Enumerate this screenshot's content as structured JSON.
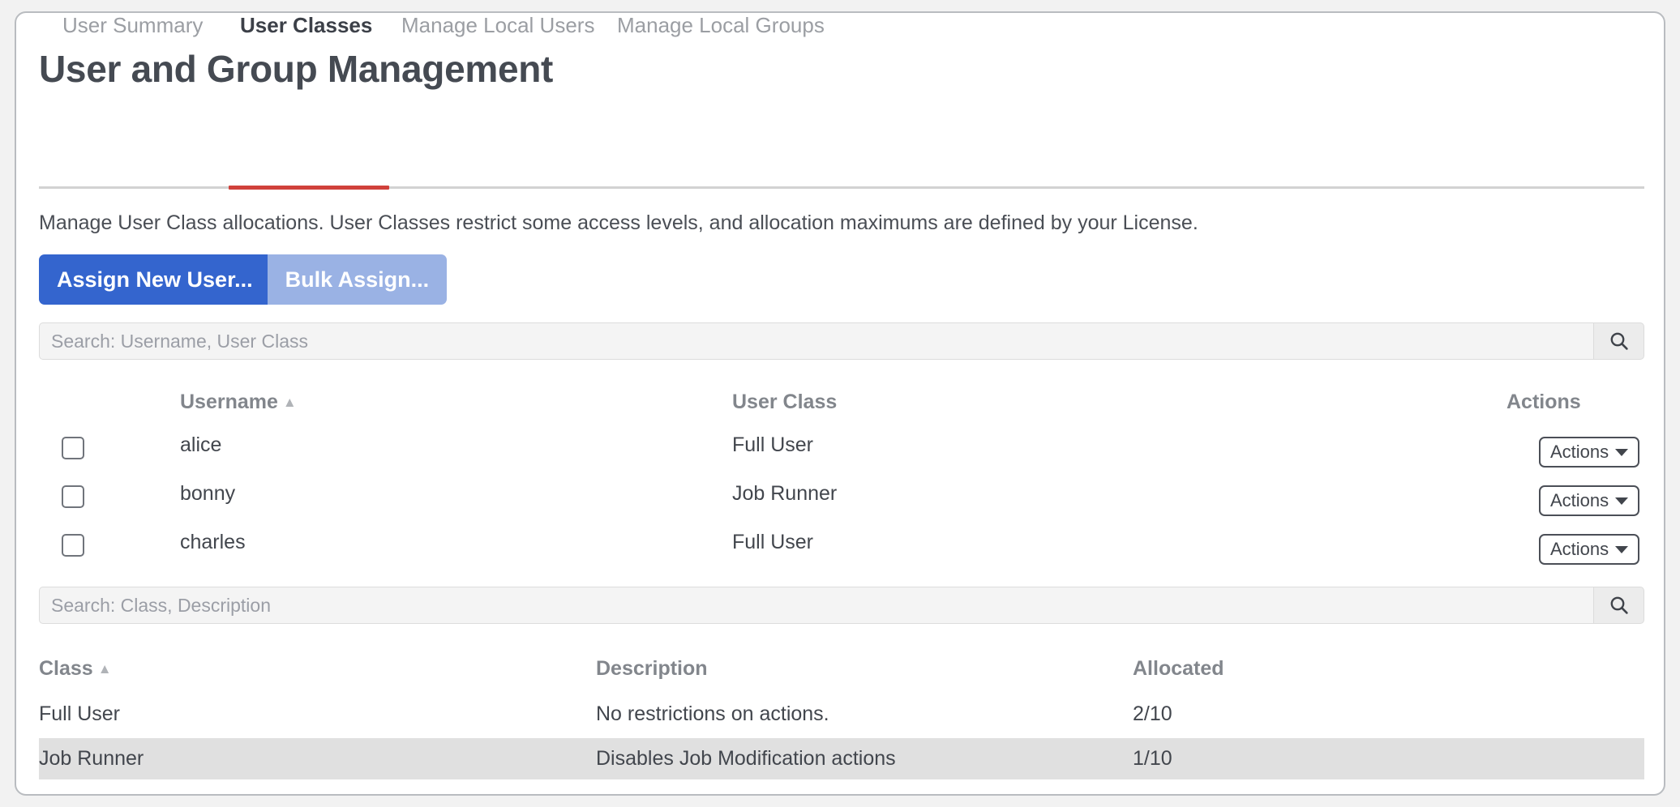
{
  "page": {
    "title": "User and Group Management"
  },
  "tabs": [
    {
      "label": "User Summary",
      "active": false
    },
    {
      "label": "User Classes",
      "active": true
    },
    {
      "label": "Manage Local Users",
      "active": false
    },
    {
      "label": "Manage Local Groups",
      "active": false
    }
  ],
  "description": "Manage User Class allocations. User Classes restrict some access levels, and allocation maximums are defined by your License.",
  "buttons": {
    "assign_new_user": "Assign New User...",
    "bulk_assign": "Bulk Assign..."
  },
  "colors": {
    "primary_blue": "#3465ce",
    "secondary_blue": "#9ab2e4",
    "active_tab_underline": "#d0413b",
    "row_highlight": "#e0e0e0"
  },
  "users_search": {
    "placeholder": "Search: Username, User Class",
    "value": "",
    "button_icon": "search-icon"
  },
  "users_table": {
    "headers": {
      "username": "Username",
      "username_sort": "▲",
      "user_class": "User Class",
      "actions": "Actions"
    },
    "rows": [
      {
        "checked": false,
        "username": "alice",
        "user_class": "Full User",
        "action_label": "Actions"
      },
      {
        "checked": false,
        "username": "bonny",
        "user_class": "Job Runner",
        "action_label": "Actions"
      },
      {
        "checked": false,
        "username": "charles",
        "user_class": "Full User",
        "action_label": "Actions"
      }
    ]
  },
  "classes_search": {
    "placeholder": "Search: Class, Description",
    "value": "",
    "button_icon": "search-icon"
  },
  "classes_table": {
    "headers": {
      "class": "Class",
      "class_sort": "▲",
      "description": "Description",
      "allocated": "Allocated"
    },
    "rows": [
      {
        "class": "Full User",
        "description": "No restrictions on actions.",
        "allocated": "2/10",
        "highlighted": false
      },
      {
        "class": "Job Runner",
        "description": "Disables Job Modification actions",
        "allocated": "1/10",
        "highlighted": true
      }
    ]
  }
}
